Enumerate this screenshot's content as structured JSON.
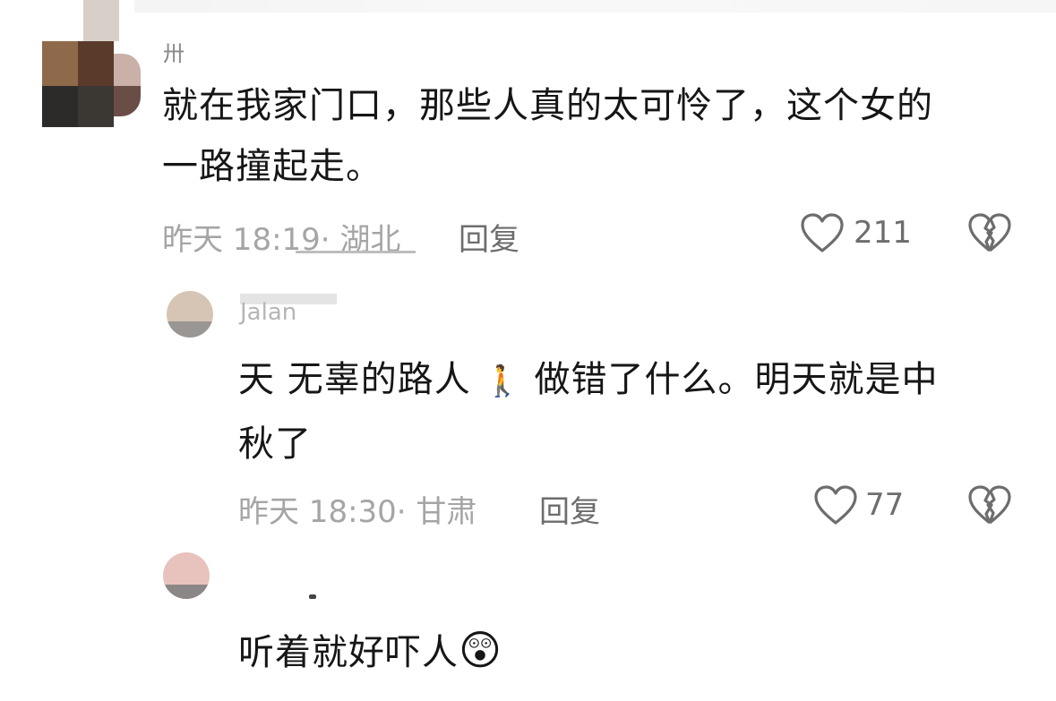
{
  "comments": [
    {
      "username": "卅",
      "text_line1": "就在我家门口，那些人真的太可怜了，这个女的",
      "text_line2": "一路撞起走。",
      "time": "昨天 18:19",
      "location": "· 湖北",
      "reply": "回复",
      "likes": "211"
    },
    {
      "username": "Jalan",
      "text_line1_a": "天 无辜的路人",
      "emoji1": "🚶",
      "text_line1_b": "做错了什么。明天就是中",
      "text_line2": "秋了",
      "time": "昨天 18:30",
      "location": "· 甘肃",
      "reply": "回复",
      "likes": "77"
    },
    {
      "username": "",
      "text": "听着就好吓人",
      "emoji": "😲"
    }
  ],
  "colors": {
    "text": "#161616",
    "meta": "#a5a5a5",
    "secondary": "#6d6d6d",
    "background": "#ffffff"
  },
  "icons": [
    "heart-outline-icon",
    "broken-heart-icon"
  ]
}
